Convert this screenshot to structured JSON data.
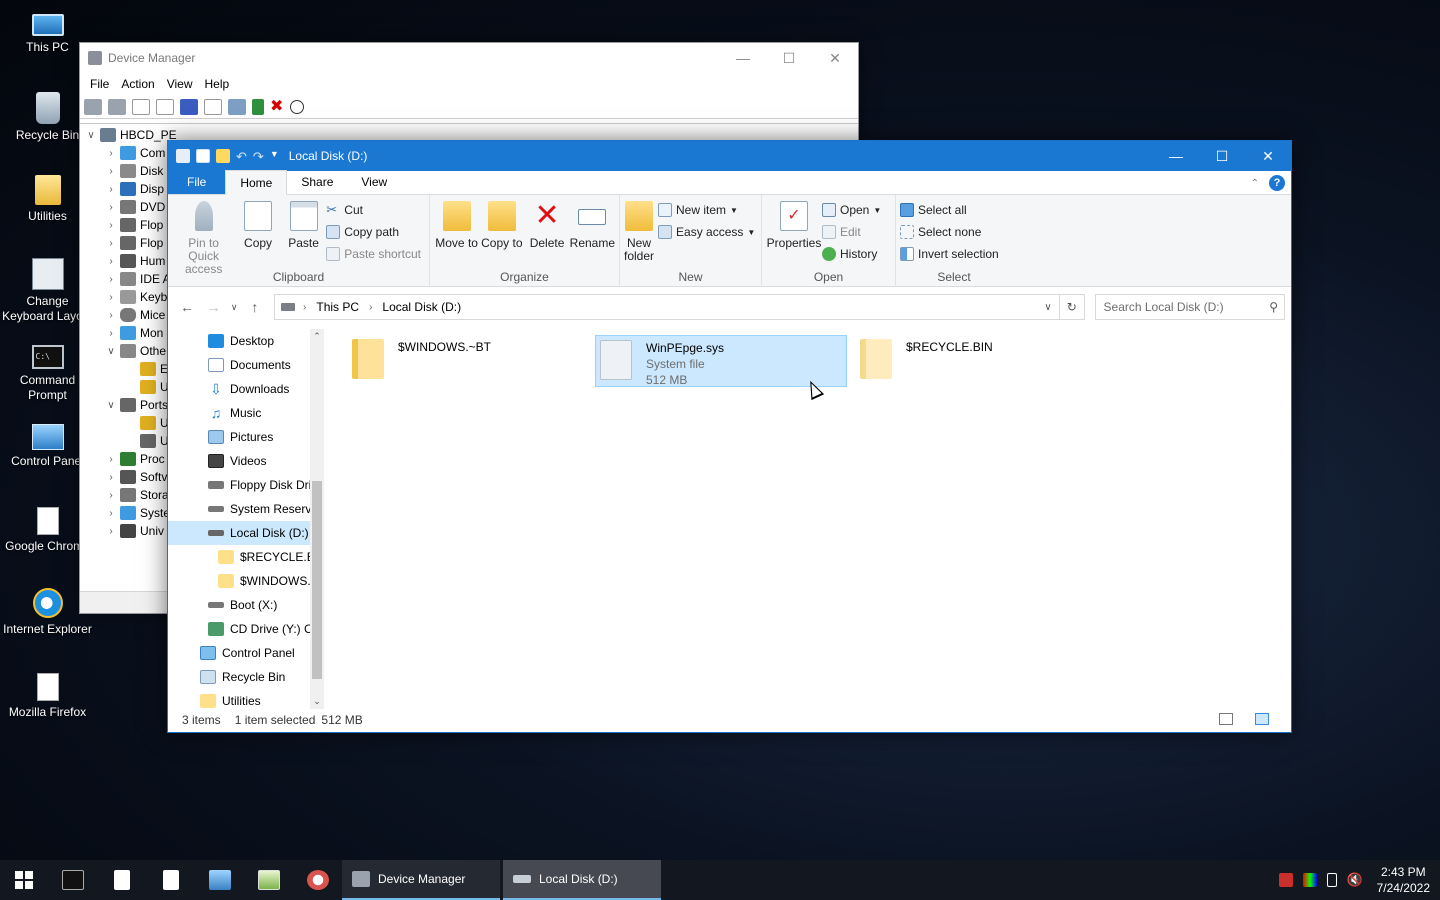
{
  "desktop": {
    "icons": [
      {
        "label": "This PC",
        "icon": "computer-icon"
      },
      {
        "label": "Recycle Bin",
        "icon": "recycle-bin-icon"
      },
      {
        "label": "Utilities",
        "icon": "folder-icon"
      },
      {
        "label": "Change Keyboard Layout",
        "icon": "keyboard-settings-icon"
      },
      {
        "label": "Command Prompt",
        "icon": "command-prompt-icon"
      },
      {
        "label": "Control Panel",
        "icon": "control-panel-icon"
      },
      {
        "label": "Google Chrome",
        "icon": "document-icon"
      },
      {
        "label": "Internet Explorer",
        "icon": "internet-explorer-icon"
      },
      {
        "label": "Mozilla Firefox",
        "icon": "document-icon"
      }
    ]
  },
  "device_manager": {
    "title": "Device Manager",
    "menu": [
      "File",
      "Action",
      "View",
      "Help"
    ],
    "root": "HBCD_PE",
    "nodes": [
      {
        "label": "Com",
        "expanded": false
      },
      {
        "label": "Disk",
        "expanded": false
      },
      {
        "label": "Disp",
        "expanded": false
      },
      {
        "label": "DVD",
        "expanded": false
      },
      {
        "label": "Flop",
        "expanded": false
      },
      {
        "label": "Flop",
        "expanded": false
      },
      {
        "label": "Hum",
        "expanded": false
      },
      {
        "label": "IDE A",
        "expanded": false
      },
      {
        "label": "Keyb",
        "expanded": false
      },
      {
        "label": "Mice",
        "expanded": false
      },
      {
        "label": "Mon",
        "expanded": false
      },
      {
        "label": "Othe",
        "expanded": true
      },
      {
        "label": "E",
        "child": true
      },
      {
        "label": "U",
        "child": true
      },
      {
        "label": "Ports",
        "expanded": true
      },
      {
        "label": "U",
        "child": true
      },
      {
        "label": "U",
        "child": true
      },
      {
        "label": "Proc",
        "expanded": false
      },
      {
        "label": "Softv",
        "expanded": false
      },
      {
        "label": "Stora",
        "expanded": false
      },
      {
        "label": "Syste",
        "expanded": false
      },
      {
        "label": "Univ",
        "expanded": false
      }
    ]
  },
  "explorer": {
    "title": "Local Disk (D:)",
    "tabs": {
      "file": "File",
      "home": "Home",
      "share": "Share",
      "view": "View"
    },
    "ribbon": {
      "clipboard": {
        "label": "Clipboard",
        "pin": "Pin to Quick access",
        "copy": "Copy",
        "paste": "Paste",
        "cut": "Cut",
        "copy_path": "Copy path",
        "paste_shortcut": "Paste shortcut"
      },
      "organize": {
        "label": "Organize",
        "move_to": "Move to",
        "copy_to": "Copy to",
        "delete": "Delete",
        "rename": "Rename"
      },
      "new": {
        "label": "New",
        "new_folder": "New folder",
        "new_item": "New item",
        "easy_access": "Easy access"
      },
      "open": {
        "label": "Open",
        "properties": "Properties",
        "open": "Open",
        "edit": "Edit",
        "history": "History"
      },
      "select": {
        "label": "Select",
        "select_all": "Select all",
        "select_none": "Select none",
        "invert": "Invert selection"
      }
    },
    "address": {
      "crumbs": [
        "This PC",
        "Local Disk (D:)"
      ]
    },
    "search_placeholder": "Search Local Disk (D:)",
    "nav": [
      {
        "label": "Desktop",
        "indent": 1
      },
      {
        "label": "Documents",
        "indent": 1
      },
      {
        "label": "Downloads",
        "indent": 1
      },
      {
        "label": "Music",
        "indent": 1
      },
      {
        "label": "Pictures",
        "indent": 1
      },
      {
        "label": "Videos",
        "indent": 1
      },
      {
        "label": "Floppy Disk Dri",
        "indent": 1
      },
      {
        "label": "System Reserve",
        "indent": 1
      },
      {
        "label": "Local Disk (D:)",
        "indent": 1,
        "selected": true
      },
      {
        "label": "$RECYCLE.BIN",
        "indent": 2
      },
      {
        "label": "$WINDOWS.~",
        "indent": 2
      },
      {
        "label": "Boot (X:)",
        "indent": 1
      },
      {
        "label": "CD Drive (Y:) C",
        "indent": 1
      },
      {
        "label": "Control Panel",
        "indent": 0
      },
      {
        "label": "Recycle Bin",
        "indent": 0
      },
      {
        "label": "Utilities",
        "indent": 0
      }
    ],
    "files": [
      {
        "name": "$WINDOWS.~BT",
        "type": "folder"
      },
      {
        "name": "WinPEpge.sys",
        "subtitle": "System file",
        "size": "512 MB",
        "type": "system",
        "selected": true
      },
      {
        "name": "$RECYCLE.BIN",
        "type": "folder"
      }
    ],
    "status": {
      "count": "3 items",
      "selected": "1 item selected",
      "size": "512 MB"
    }
  },
  "taskbar": {
    "tasks": [
      {
        "label": "Device Manager",
        "active": false
      },
      {
        "label": "Local Disk (D:)",
        "active": true
      }
    ],
    "clock": {
      "time": "2:43 PM",
      "date": "7/24/2022"
    }
  },
  "colors": {
    "accent": "#1a78d2",
    "selection": "#cce8ff"
  }
}
